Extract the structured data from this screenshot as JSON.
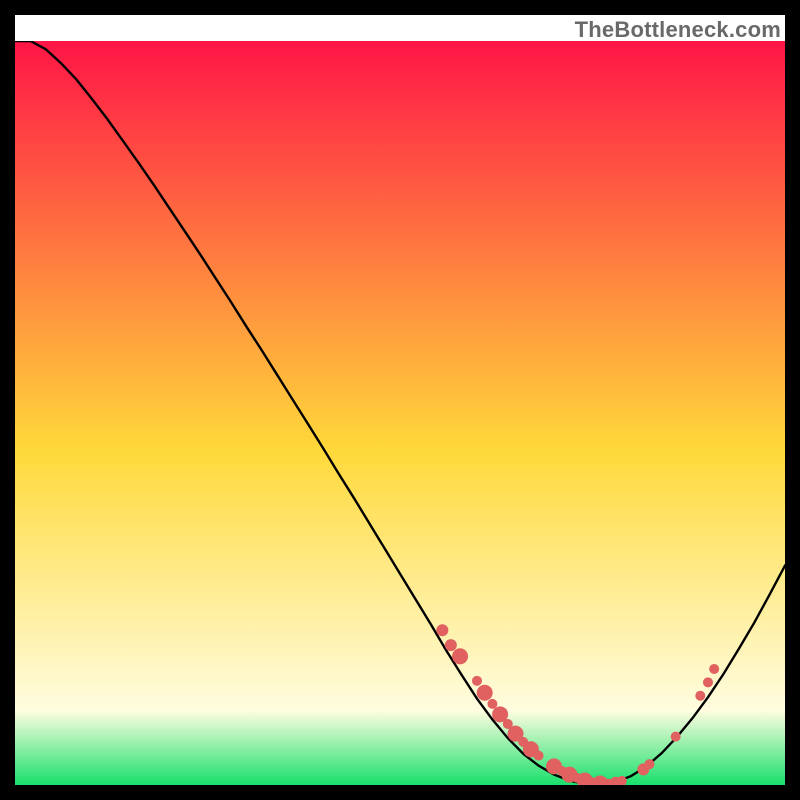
{
  "attribution": "TheBottleneck.com",
  "colors": {
    "page_bg": "#000000",
    "frame_bg": "#ffffff",
    "gradient_top": "#ff1546",
    "gradient_mid": "#ffd93a",
    "gradient_haze": "#fffde0",
    "gradient_bottom": "#18e06b",
    "curve": "#000000",
    "marker": "#e0615f"
  },
  "chart_data": {
    "type": "line",
    "title": "",
    "xlabel": "",
    "ylabel": "",
    "xlim": [
      0,
      100
    ],
    "ylim": [
      0,
      100
    ],
    "x": [
      0,
      2,
      4,
      6,
      8,
      10,
      12,
      14,
      16,
      18,
      20,
      22,
      24,
      26,
      28,
      30,
      32,
      34,
      36,
      38,
      40,
      42,
      44,
      46,
      48,
      50,
      52,
      54,
      56,
      58,
      60,
      62,
      64,
      66,
      68,
      70,
      72,
      74,
      76,
      78,
      80,
      82,
      84,
      86,
      88,
      90,
      92,
      94,
      96,
      98,
      100
    ],
    "values": [
      100,
      100,
      98.9,
      97.0,
      94.8,
      92.2,
      89.5,
      86.6,
      83.7,
      80.7,
      77.6,
      74.5,
      71.4,
      68.2,
      65.0,
      61.7,
      58.5,
      55.2,
      51.9,
      48.6,
      45.3,
      41.9,
      38.6,
      35.2,
      31.8,
      28.4,
      25.0,
      21.6,
      18.1,
      14.8,
      11.6,
      8.8,
      6.3,
      4.2,
      2.6,
      1.4,
      0.6,
      0.15,
      0.02,
      0.4,
      1.2,
      2.5,
      4.3,
      6.5,
      9.0,
      11.8,
      14.9,
      18.3,
      21.8,
      25.6,
      29.5
    ],
    "series": [
      {
        "name": "markers",
        "type": "scatter",
        "x": [
          55.5,
          56.6,
          57.8,
          60.0,
          61.0,
          62.0,
          63.0,
          64.0,
          65.0,
          66.0,
          67.0,
          68.0,
          70.0,
          71.0,
          72.0,
          73.0,
          74.0,
          75.0,
          76.0,
          77.0,
          78.0,
          78.8,
          81.6,
          82.4,
          85.8,
          89.0,
          90.0,
          90.8
        ],
        "values": [
          20.8,
          18.8,
          17.3,
          14.0,
          12.4,
          10.9,
          9.5,
          8.2,
          6.9,
          5.8,
          4.8,
          3.95,
          2.5,
          1.9,
          1.4,
          0.95,
          0.6,
          0.35,
          0.2,
          0.18,
          0.3,
          0.55,
          2.1,
          2.8,
          6.5,
          12.0,
          13.8,
          15.6
        ],
        "sizes": [
          6,
          6,
          8,
          5,
          8,
          5,
          8,
          5,
          8,
          5,
          8,
          5,
          8,
          5,
          8,
          5,
          8,
          5,
          8,
          5,
          6,
          5,
          6,
          5,
          5,
          5,
          5,
          5
        ]
      }
    ]
  }
}
